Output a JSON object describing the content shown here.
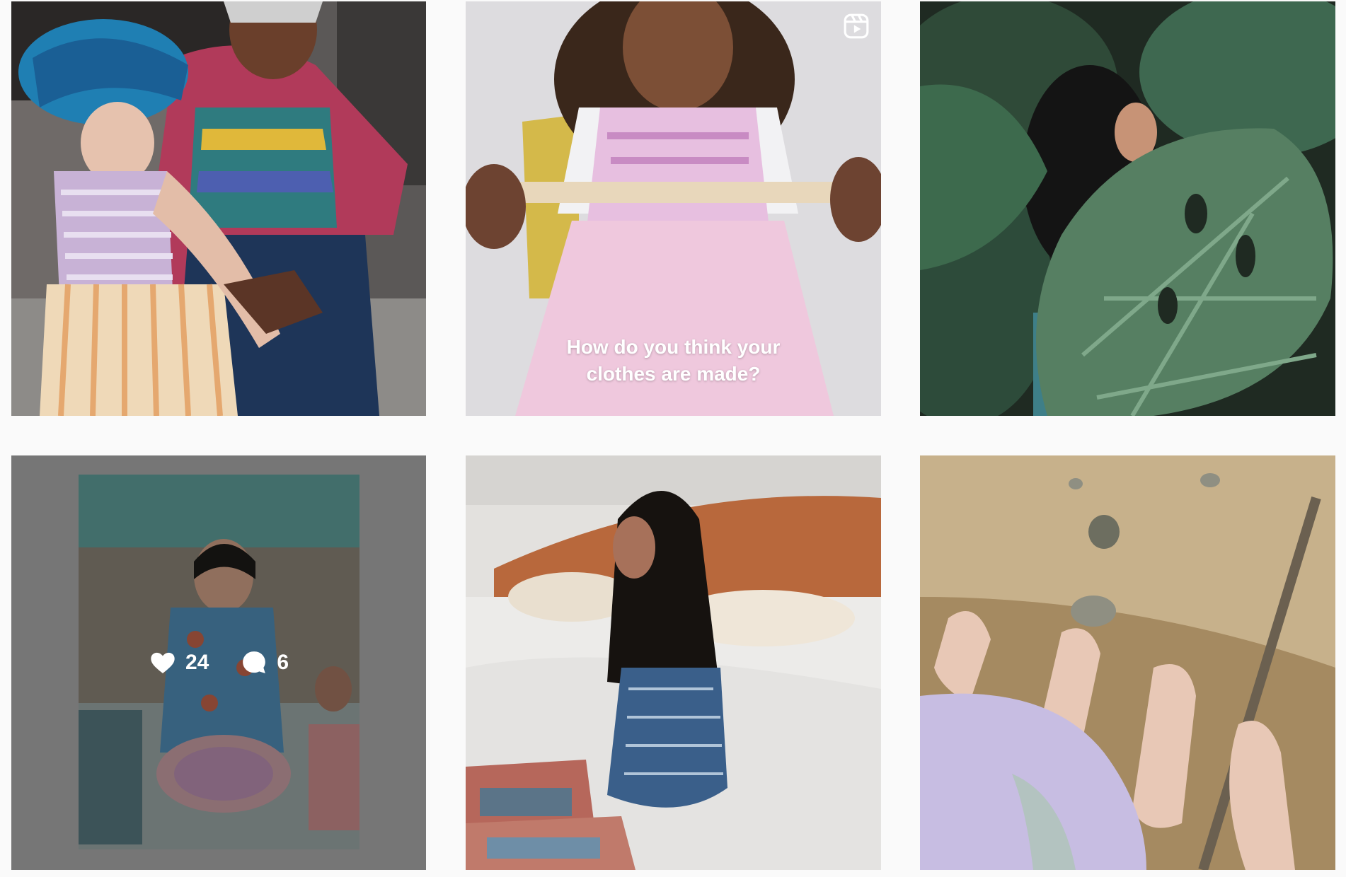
{
  "grid": {
    "posts": [
      {
        "alt": "",
        "type": "photo"
      },
      {
        "alt": "",
        "type": "reel",
        "reel_icon": "reel-icon",
        "caption_lines": [
          "How do you think your",
          "clothes are made?"
        ]
      },
      {
        "alt": "",
        "type": "photo"
      },
      {
        "alt": "",
        "type": "photo",
        "hovered": true,
        "likes": "24",
        "comments": "6",
        "like_icon": "heart-icon",
        "comment_icon": "comment-icon"
      },
      {
        "alt": "",
        "type": "photo"
      },
      {
        "alt": "",
        "type": "photo"
      }
    ]
  },
  "colors": {
    "background": "#fafafa",
    "overlay": "rgba(0,0,0,0.3)",
    "text": "#ffffff"
  }
}
